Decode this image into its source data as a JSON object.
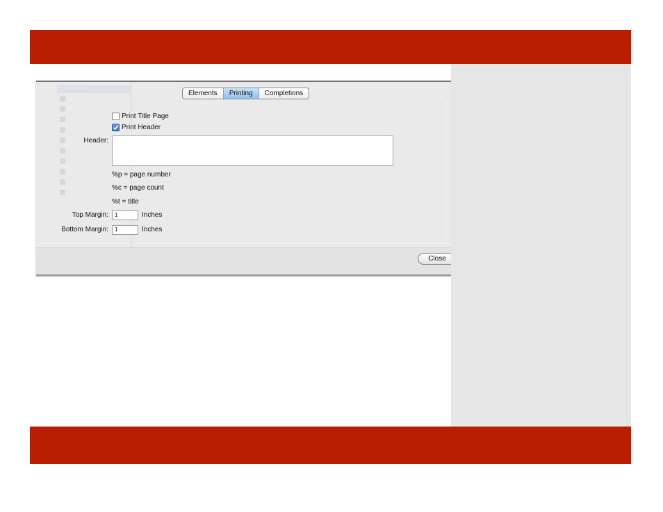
{
  "sheet": {
    "tabs": [
      {
        "label": "Elements",
        "active": false
      },
      {
        "label": "Printing",
        "active": true
      },
      {
        "label": "Completions",
        "active": false
      }
    ],
    "print_title_page": {
      "label": "Print Title Page",
      "checked": false
    },
    "print_header": {
      "label": "Print Header",
      "checked": true
    },
    "header_label": "Header:",
    "header_value": "",
    "hints": [
      "%p = page number",
      "%c = page count",
      "%t = title"
    ],
    "top_margin": {
      "label": "Top Margin:",
      "value": "1",
      "unit": "Inches"
    },
    "bottom_margin": {
      "label": "Bottom Margin:",
      "value": "1",
      "unit": "Inches"
    },
    "close_label": "Close"
  },
  "colors": {
    "bar": "#ba1e02",
    "side_panel": "#e6e6e6",
    "tab_active": "#8fc1f2"
  }
}
